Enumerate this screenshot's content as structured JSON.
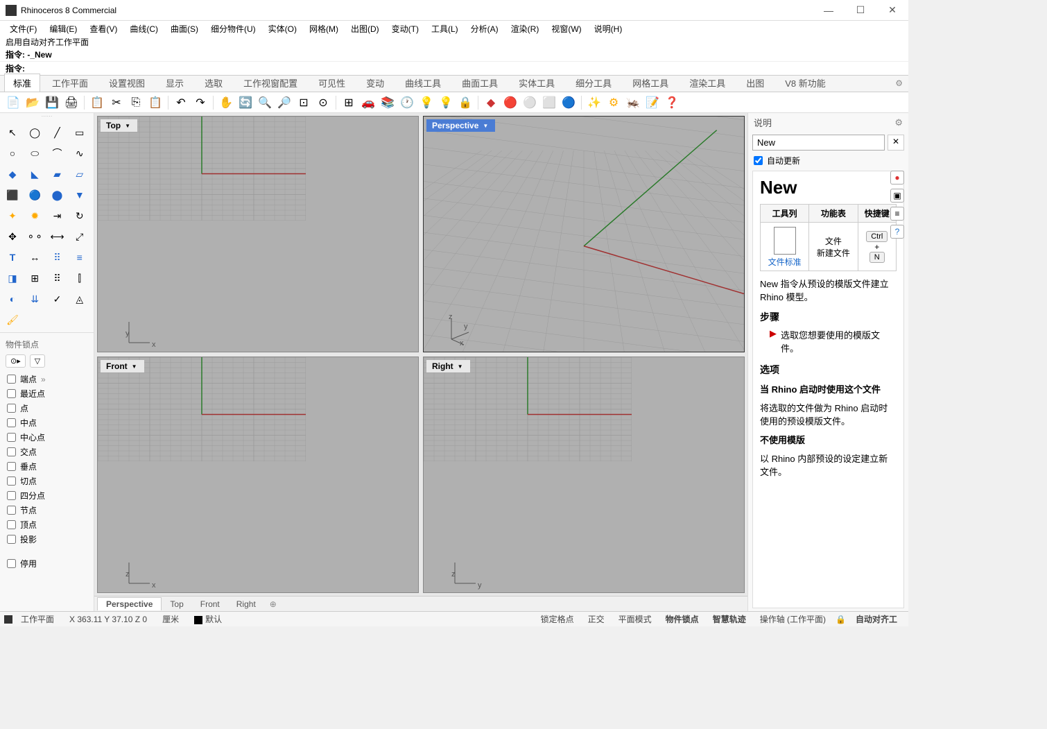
{
  "title": "Rhinoceros 8 Commercial",
  "menus": [
    "文件(F)",
    "编辑(E)",
    "查看(V)",
    "曲线(C)",
    "曲面(S)",
    "细分物件(U)",
    "实体(O)",
    "网格(M)",
    "出图(D)",
    "变动(T)",
    "工具(L)",
    "分析(A)",
    "渲染(R)",
    "视窗(W)",
    "说明(H)"
  ],
  "cmd_history": [
    "启用自动对齐工作平面",
    "指令: -_New"
  ],
  "cmd_prompt": "指令:",
  "tabs": [
    "标准",
    "工作平面",
    "设置视图",
    "显示",
    "选取",
    "工作视窗配置",
    "可见性",
    "变动",
    "曲线工具",
    "曲面工具",
    "实体工具",
    "细分工具",
    "网格工具",
    "渲染工具",
    "出图",
    "V8 新功能"
  ],
  "active_tab": 0,
  "viewports": {
    "top": "Top",
    "perspective": "Perspective",
    "front": "Front",
    "right": "Right"
  },
  "osnap": {
    "title": "物件锁点",
    "items": [
      "端点",
      "最近点",
      "点",
      "中点",
      "中心点",
      "交点",
      "垂点",
      "切点",
      "四分点",
      "节点",
      "顶点",
      "投影"
    ],
    "pause": "停用"
  },
  "viewport_tabs": [
    "Perspective",
    "Top",
    "Front",
    "Right"
  ],
  "active_vp_tab": 0,
  "help": {
    "panel_title": "说明",
    "search_value": "New",
    "auto_update": "自动更新",
    "heading": "New",
    "table": {
      "h1": "工具列",
      "h2": "功能表",
      "h3": "快捷键",
      "c1": "文件标准",
      "c2a": "文件",
      "c2b": "新建文件",
      "k1": "Ctrl",
      "kplus": "+",
      "k2": "N"
    },
    "desc": "New 指令从预设的模版文件建立 Rhino 模型。",
    "steps_h": "步骤",
    "step1": "选取您想要使用的模版文件。",
    "options_h": "选项",
    "opt1_h": "当 Rhino 启动时使用这个文件",
    "opt1_b": "将选取的文件做为 Rhino 启动时使用的预设模版文件。",
    "opt2_h": "不使用模版",
    "opt2_b": "以 Rhino 内部预设的设定建立新文件。"
  },
  "status": {
    "cplane": "工作平面",
    "coords": "X 363.11 Y 37.10 Z 0",
    "units": "厘米",
    "layer": "默认",
    "items": [
      "锁定格点",
      "正交",
      "平面模式",
      "物件锁点",
      "智慧轨迹",
      "操作轴 (工作平面)",
      "自动对齐工"
    ],
    "bold_items": [
      3,
      4,
      6
    ]
  }
}
